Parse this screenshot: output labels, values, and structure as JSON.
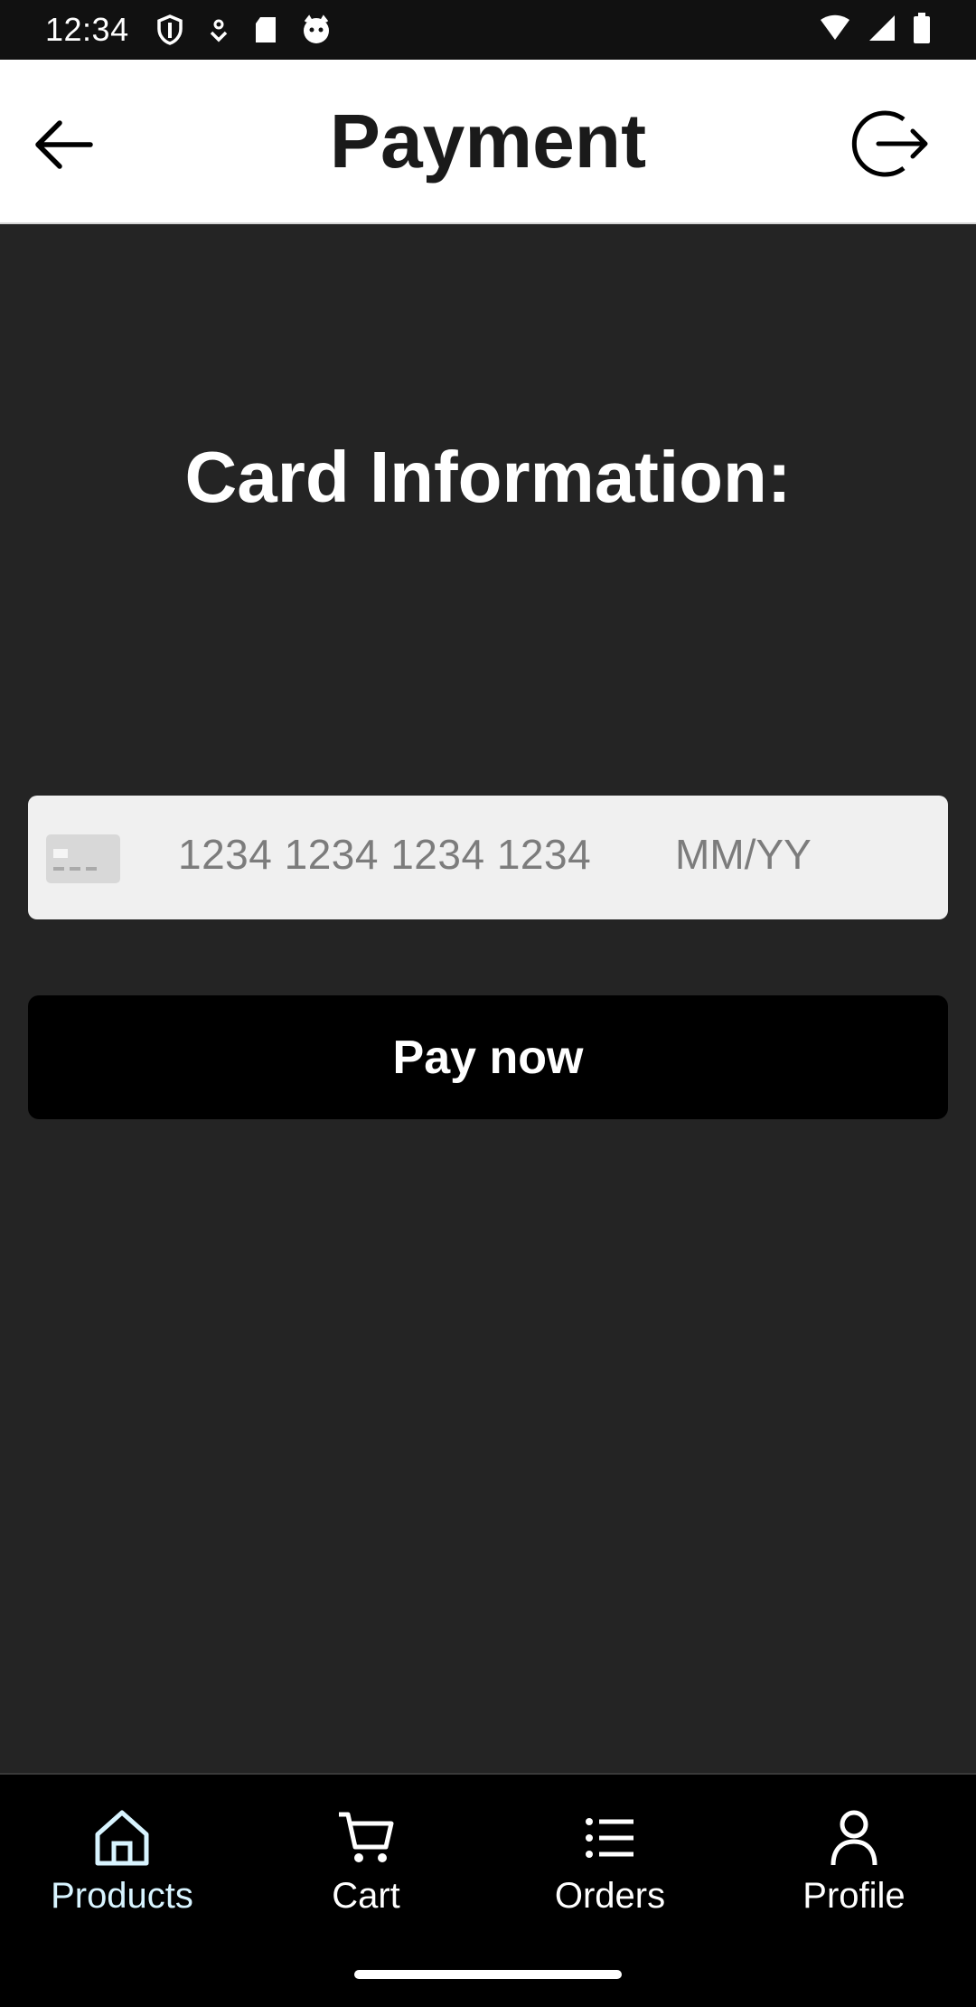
{
  "status_bar": {
    "time": "12:34",
    "left_icons": [
      "shield-icon",
      "notification-icon",
      "sd-card-icon",
      "cat-icon"
    ],
    "right_icons": [
      "wifi-icon",
      "signal-icon",
      "battery-icon"
    ]
  },
  "app_bar": {
    "title": "Payment",
    "back_icon": "arrow-left-icon",
    "logout_icon": "logout-icon"
  },
  "main": {
    "section_title": "Card Information:",
    "card_field": {
      "icon": "credit-card-icon",
      "number_placeholder": "1234 1234 1234 1234",
      "expiry_placeholder": "MM/YY"
    },
    "pay_button_label": "Pay now"
  },
  "bottom_nav": {
    "items": [
      {
        "label": "Products",
        "icon": "home-icon",
        "active": true
      },
      {
        "label": "Cart",
        "icon": "cart-icon",
        "active": false
      },
      {
        "label": "Orders",
        "icon": "list-icon",
        "active": false
      },
      {
        "label": "Profile",
        "icon": "person-icon",
        "active": false
      }
    ]
  },
  "colors": {
    "background": "#242424",
    "app_bar": "#ffffff",
    "card_field": "#f0f0f0",
    "pay_button": "#000000",
    "nav_active": "#d8f4ff"
  }
}
